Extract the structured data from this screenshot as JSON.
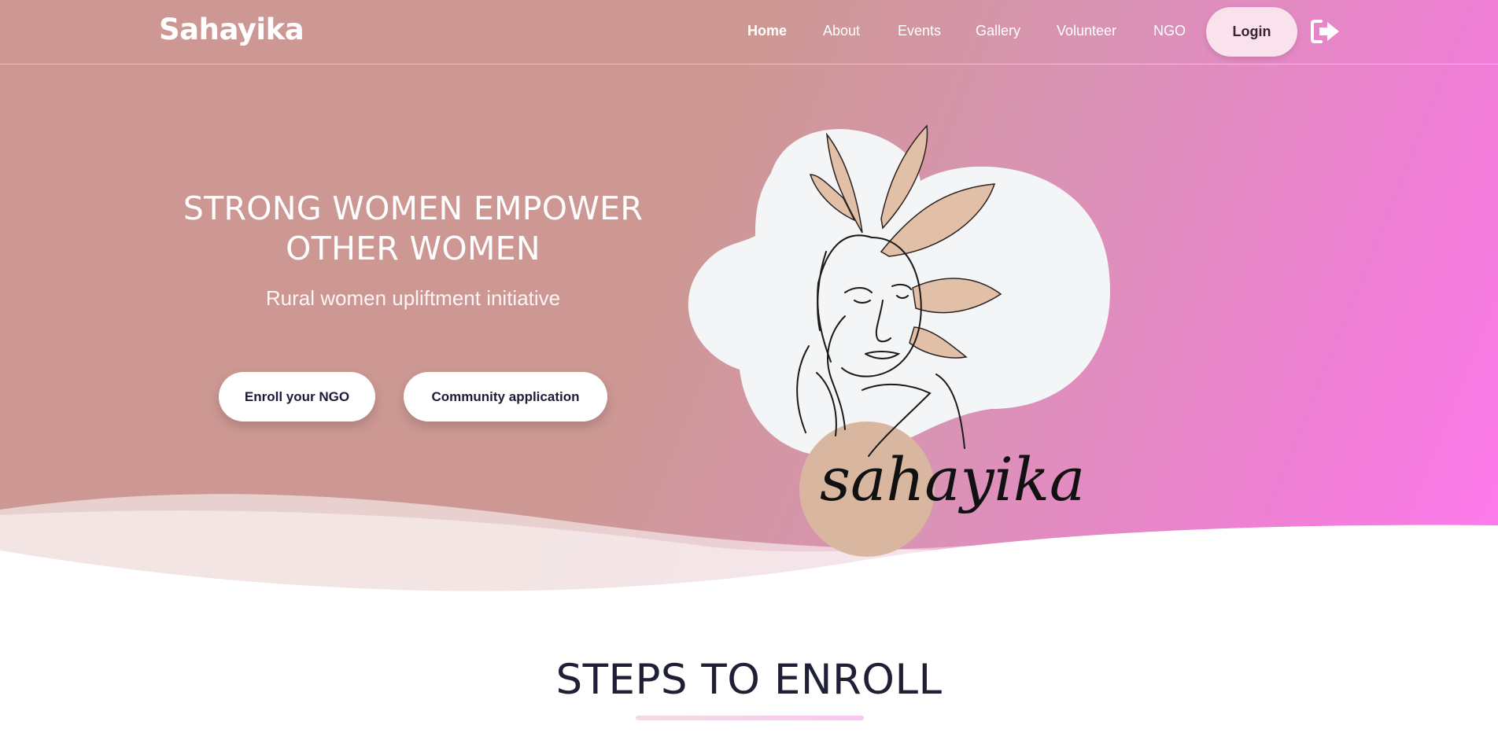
{
  "brand": "Sahayika",
  "nav": {
    "items": [
      {
        "label": "Home",
        "active": true
      },
      {
        "label": "About",
        "active": false
      },
      {
        "label": "Events",
        "active": false
      },
      {
        "label": "Gallery",
        "active": false
      },
      {
        "label": "Volunteer",
        "active": false
      },
      {
        "label": "NGO",
        "active": false
      }
    ],
    "login_label": "Login",
    "logout_icon": "sign-out-icon"
  },
  "hero": {
    "headline_line1": "STRONG WOMEN EMPOWER",
    "headline_line2": "OTHER WOMEN",
    "subheadline": "Rural women upliftment initiative",
    "enroll_button": "Enroll your NGO",
    "community_button": "Community application",
    "logo_text": "sahayika"
  },
  "steps": {
    "title": "STEPS TO ENROLL"
  },
  "colors": {
    "hero_start": "#cd9893",
    "hero_end": "#ff79ef",
    "accent_pink": "#f9e2ec",
    "title_dark": "#1f2035",
    "leaf_beige": "#e2c0a8"
  }
}
